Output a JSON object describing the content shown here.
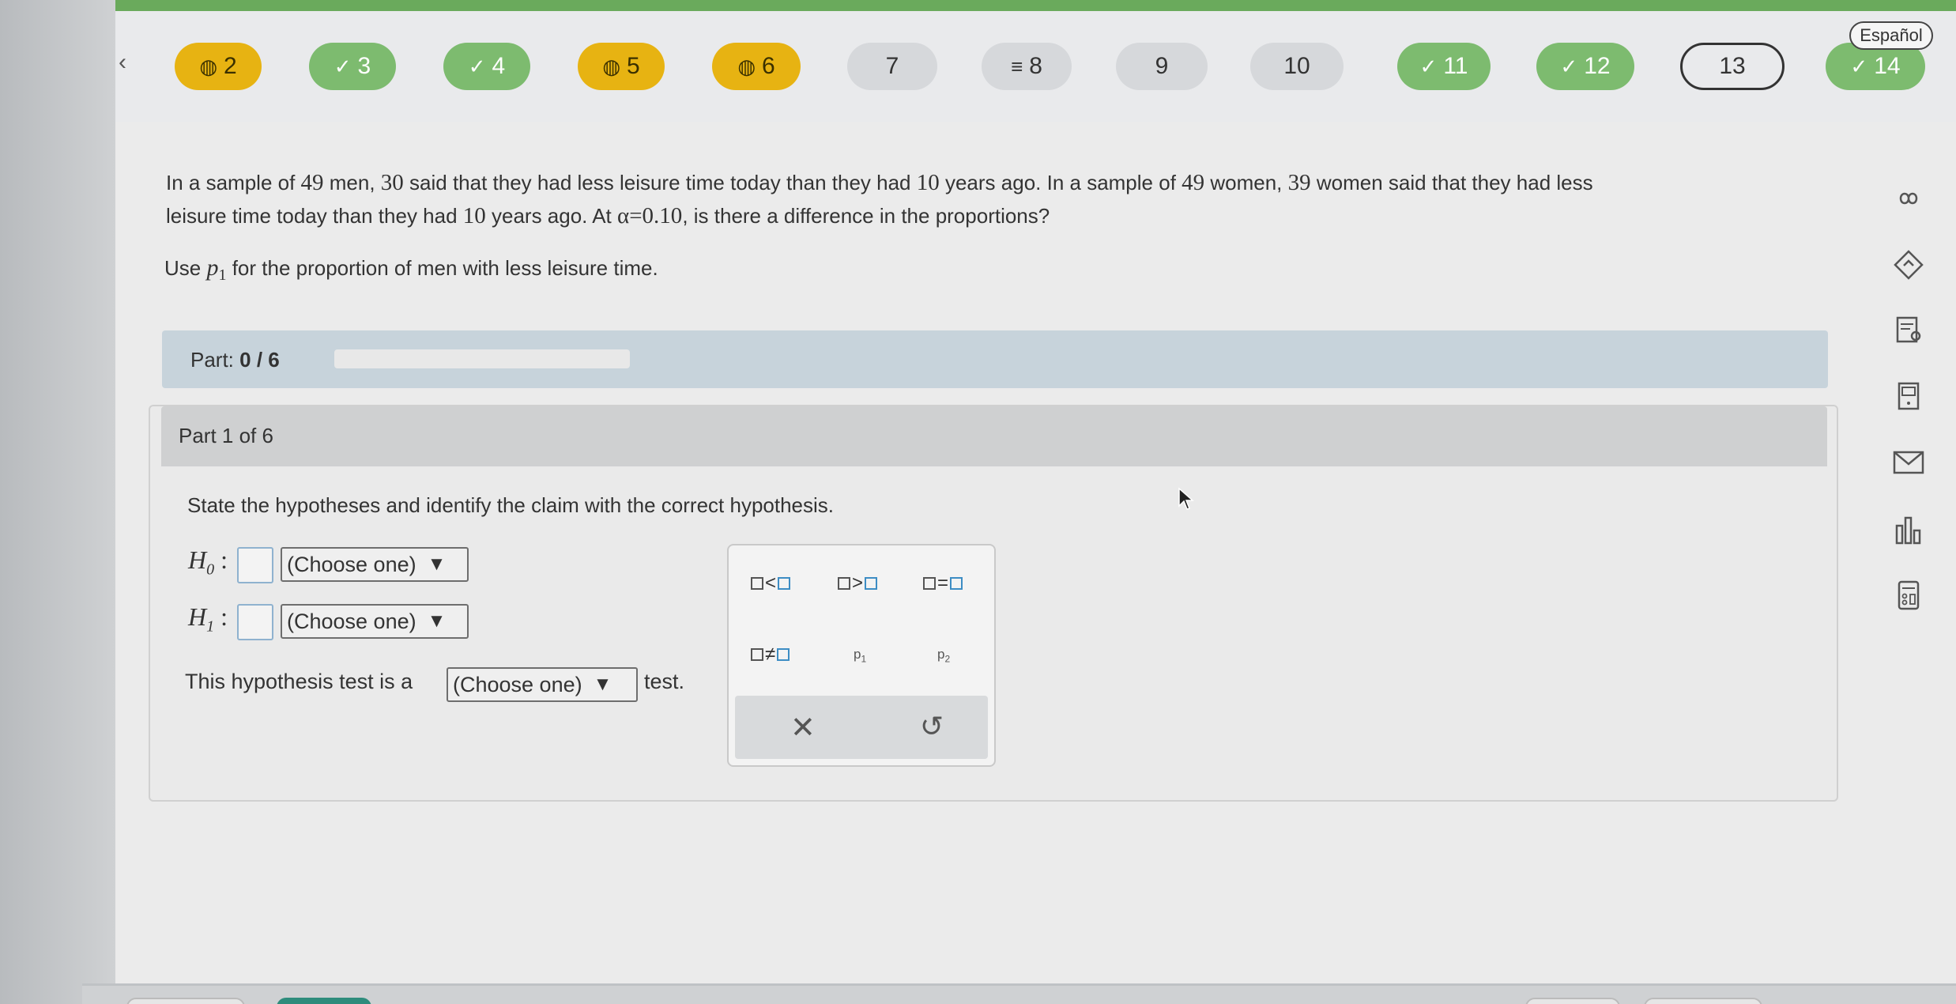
{
  "nav": {
    "back_icon": "chevron-left-icon",
    "questions": [
      {
        "label": "2",
        "state": "flagged",
        "icon": "◍"
      },
      {
        "label": "3",
        "state": "done",
        "icon": "✓"
      },
      {
        "label": "4",
        "state": "done",
        "icon": "✓"
      },
      {
        "label": "5",
        "state": "flagged",
        "icon": "◍"
      },
      {
        "label": "6",
        "state": "flagged",
        "icon": "◍"
      },
      {
        "label": "7",
        "state": "plain",
        "icon": ""
      },
      {
        "label": "8",
        "state": "plain",
        "icon": "≡"
      },
      {
        "label": "9",
        "state": "plain",
        "icon": ""
      },
      {
        "label": "10",
        "state": "plain",
        "icon": ""
      },
      {
        "label": "11",
        "state": "done",
        "icon": "✓"
      },
      {
        "label": "12",
        "state": "done",
        "icon": "✓"
      },
      {
        "label": "13",
        "state": "current",
        "icon": ""
      },
      {
        "label": "14",
        "state": "done",
        "icon": "✓"
      }
    ],
    "language_label": "Español"
  },
  "question": {
    "line1_a": "In a sample of ",
    "n_men": "49",
    "line1_b": " men, ",
    "x_men": "30",
    "line1_c": " said that they had less leisure time today than they had ",
    "years1": "10",
    "line1_d": " years ago. In a sample of ",
    "n_women": "49",
    "line1_e": " women, ",
    "x_women": "39",
    "line1_f": " women said that they had less",
    "line2_a": "leisure time today than they had ",
    "years2": "10",
    "line2_b": " years ago. At ",
    "alpha": "α=0.10",
    "line2_c": ", is there a difference in the proportions?",
    "use_prefix": "Use ",
    "use_var": "p",
    "use_var_sub": "1",
    "use_suffix": " for the proportion of men with less leisure time."
  },
  "part_bar": {
    "label": "Part: ",
    "value": "0 / 6",
    "progress_fraction": 0
  },
  "card": {
    "header": "Part 1 of 6",
    "instruction": "State the hypotheses and identify the claim with the correct hypothesis.",
    "h0_label": "H",
    "h0_sub": "0",
    "h1_label": "H",
    "h1_sub": "1",
    "colon": ":",
    "choose_one": "(Choose one)",
    "arrow": "▼",
    "test_prefix": "This hypothesis test is a",
    "test_suffix": "test."
  },
  "palette": {
    "lt": "<",
    "gt": ">",
    "eq": "=",
    "ne": "≠",
    "p1": "p",
    "p1_sub": "1",
    "p2": "p",
    "p2_sub": "2",
    "clear_icon": "✕",
    "undo_icon": "↺"
  },
  "sidebar_icons": [
    "infinity-icon",
    "tag-icon",
    "review-icon",
    "textbook-icon",
    "mail-icon",
    "chart-icon",
    "calculator-icon"
  ],
  "colors": {
    "done": "#7dbb6f",
    "flagged": "#e7b312",
    "plain": "#d6d8db",
    "topbar": "#6aaa5c"
  }
}
